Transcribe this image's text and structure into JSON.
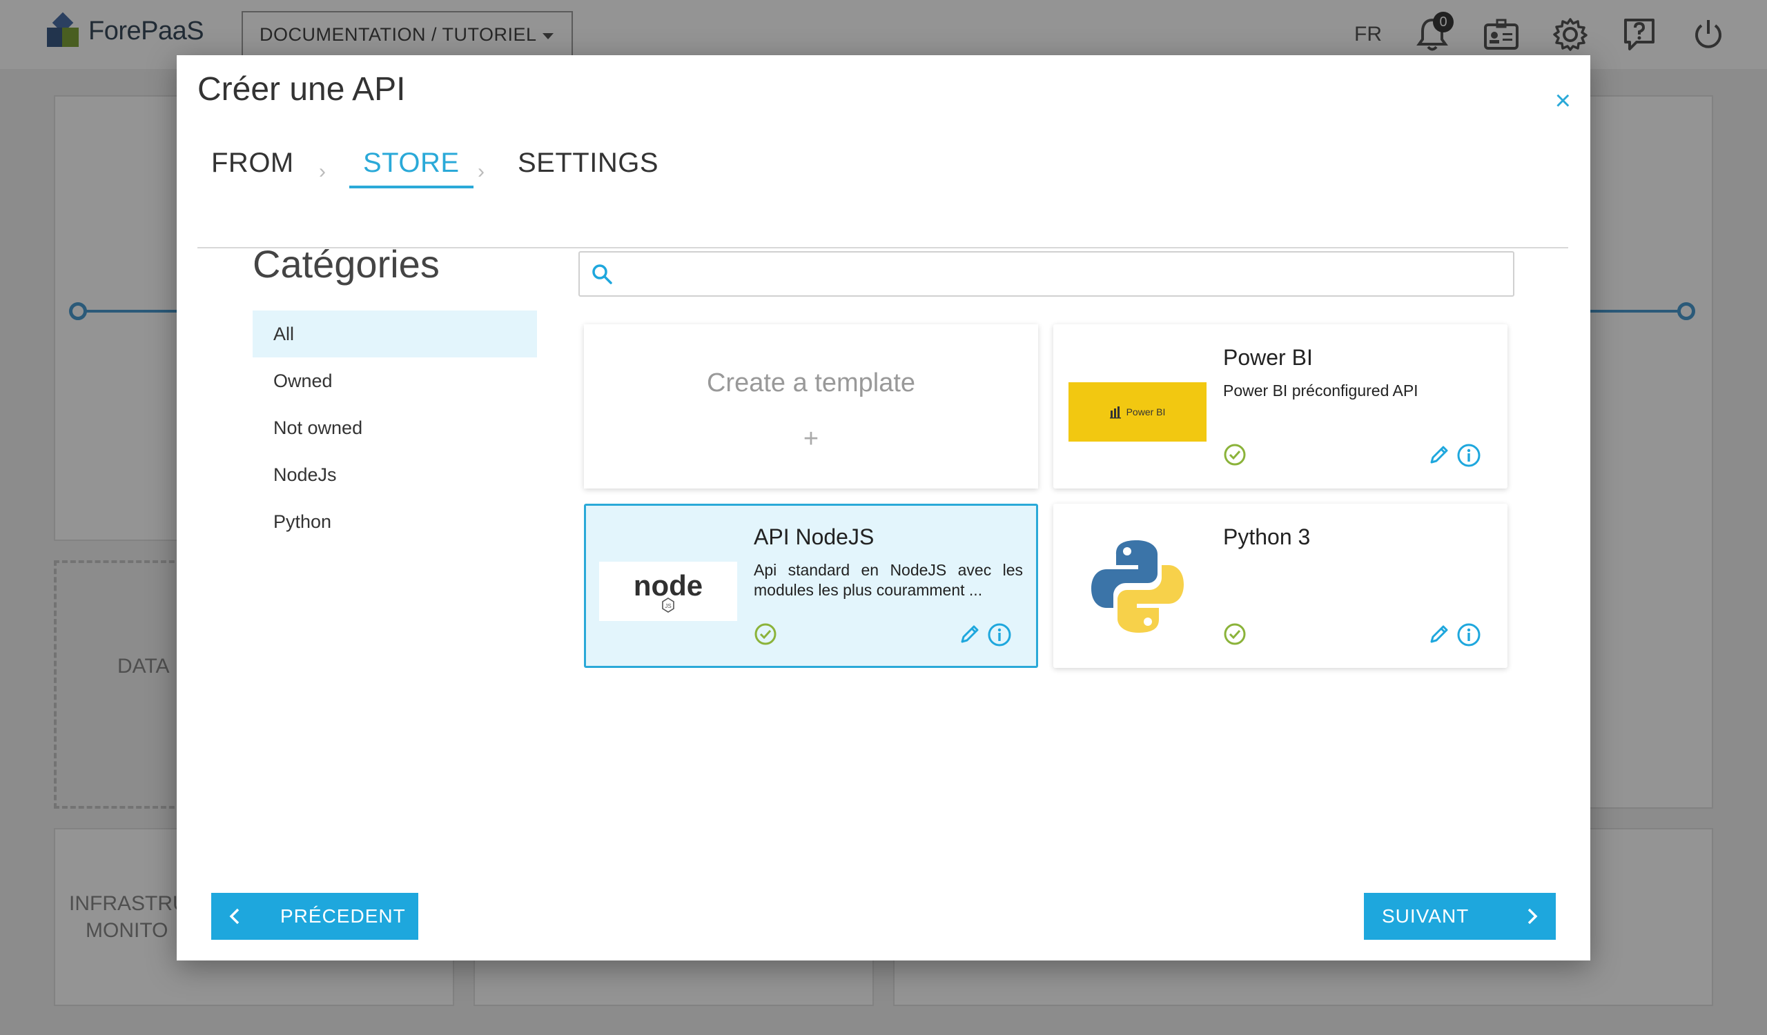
{
  "topbar": {
    "logo_text": "ForePaaS",
    "project": "DOCUMENTATION / TUTORIEL",
    "language": "FR",
    "notifications_count": "0",
    "icons": [
      "bell-icon",
      "id-badge-icon",
      "gear-icon",
      "help-icon",
      "power-icon"
    ]
  },
  "background": {
    "data_label": "DATA",
    "infra_label_line1": "INFRASTRU",
    "infra_label_line2": "MONITO"
  },
  "modal": {
    "title": "Créer une API",
    "close": "×"
  },
  "steps": {
    "from": "FROM",
    "store": "STORE",
    "settings": "SETTINGS",
    "active": "STORE"
  },
  "categories": {
    "title": "Catégories",
    "items": [
      "All",
      "Owned",
      "Not owned",
      "NodeJs",
      "Python"
    ],
    "selected": "All"
  },
  "search": {
    "value": "",
    "placeholder": ""
  },
  "templates": {
    "create": {
      "label": "Create a template",
      "plus": "+"
    },
    "powerbi": {
      "name": "Power BI",
      "description": "Power BI préconfigured API",
      "thumb_text": "Power BI",
      "thumb_color": "#f2c811"
    },
    "nodejs": {
      "name": "API NodeJS",
      "description": "Api standard en NodeJS avec les modules les plus couramment ...",
      "thumb_text": "node",
      "selected": true
    },
    "python": {
      "name": "Python 3",
      "description": ""
    }
  },
  "buttons": {
    "prev": "PRÉCEDENT",
    "next": "SUIVANT"
  },
  "colors": {
    "accent": "#1ea7dd",
    "selected_bg": "#e3f5fc",
    "check_green": "#8bb33a"
  }
}
